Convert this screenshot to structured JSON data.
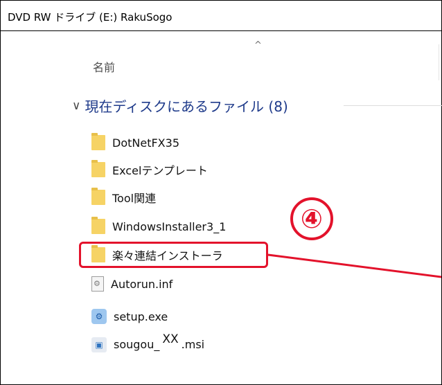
{
  "window": {
    "title": "DVD RW ドライブ (E:) RakuSogo"
  },
  "column_header": {
    "name_label": "名前",
    "sort_caret": "^"
  },
  "group": {
    "chevron": "∨",
    "label": "現在ディスクにあるファイル (8)"
  },
  "files": [
    {
      "name": "DotNetFX35",
      "icon": "folder-icon"
    },
    {
      "name": "Excelテンプレート",
      "icon": "folder-icon"
    },
    {
      "name": "Tool関連",
      "icon": "folder-icon"
    },
    {
      "name": "WindowsInstaller3_1",
      "icon": "folder-icon"
    },
    {
      "name": "楽々連結インストーラ",
      "icon": "folder-icon"
    },
    {
      "name": "Autorun.inf",
      "icon": "settings-file-icon"
    },
    {
      "name": "setup.exe",
      "icon": "setup-exe-icon"
    },
    {
      "name_prefix": "sougou_",
      "name_placeholder": "XX",
      "name_suffix": ".msi",
      "icon": "msi-installer-icon"
    }
  ],
  "annotation": {
    "step_number": "④",
    "color": "#e3122b"
  }
}
